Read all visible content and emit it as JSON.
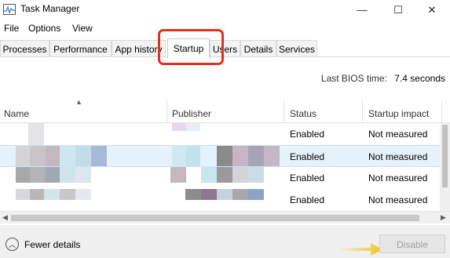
{
  "window": {
    "title": "Task Manager",
    "minimize": "—",
    "maximize": "☐",
    "close": "✕"
  },
  "menu": [
    "File",
    "Options",
    "View"
  ],
  "tabs": [
    {
      "label": "Processes"
    },
    {
      "label": "Performance"
    },
    {
      "label": "App history"
    },
    {
      "label": "Startup",
      "active": true
    },
    {
      "label": "Users"
    },
    {
      "label": "Details"
    },
    {
      "label": "Services"
    }
  ],
  "bios": {
    "label": "Last BIOS time:",
    "value": "7.4 seconds"
  },
  "columns": {
    "name": "Name",
    "publisher": "Publisher",
    "status": "Status",
    "impact": "Startup impact"
  },
  "rows": [
    {
      "status": "Enabled",
      "impact": "Not measured"
    },
    {
      "status": "Enabled",
      "impact": "Not measured"
    },
    {
      "status": "Enabled",
      "impact": "Not measured"
    },
    {
      "status": "Enabled",
      "impact": "Not measured"
    }
  ],
  "footer": {
    "fewer_details": "Fewer details",
    "disable": "Disable"
  },
  "colors": {
    "highlight": "#e0301e",
    "selected_row": "#e5f1fb",
    "annotation_arrow": "#f5c518"
  }
}
